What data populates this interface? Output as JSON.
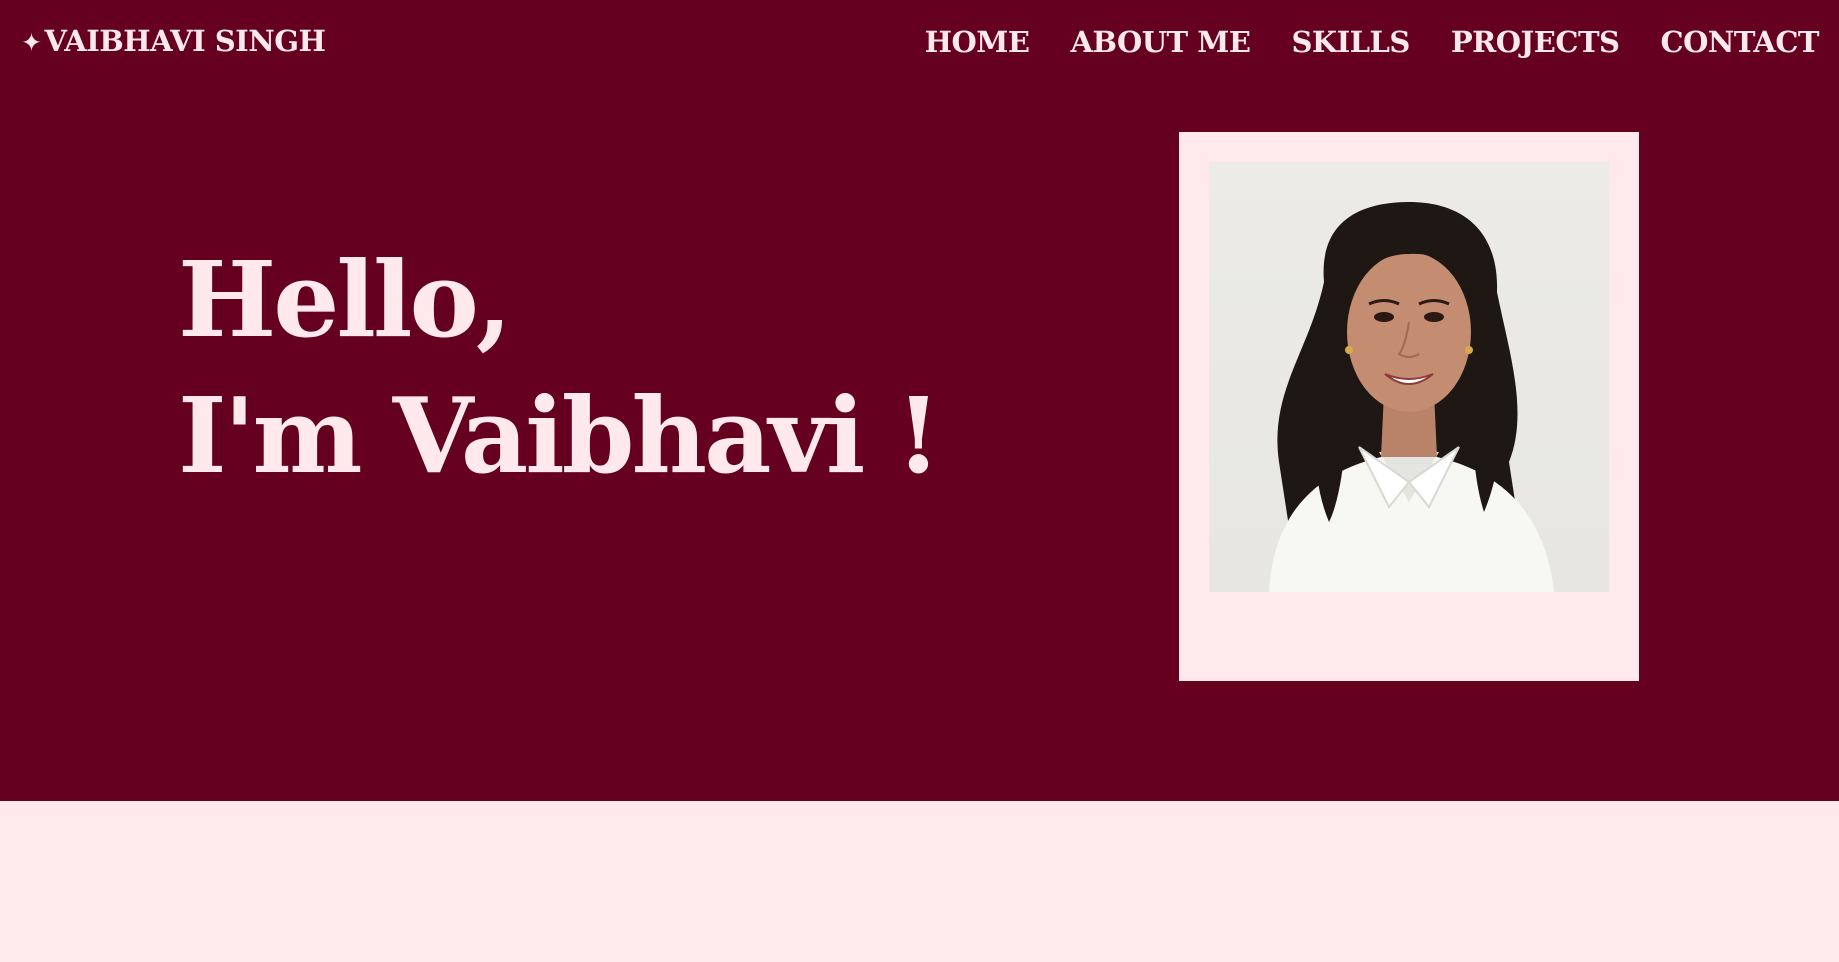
{
  "header": {
    "brand_icon": "✦",
    "brand_name": "VAIBHAVI SINGH"
  },
  "nav": {
    "items": [
      {
        "label": "HOME"
      },
      {
        "label": "ABOUT ME"
      },
      {
        "label": "SKILLS"
      },
      {
        "label": "PROJECTS"
      },
      {
        "label": "CONTACT"
      }
    ]
  },
  "hero": {
    "greeting_line1": "Hello,",
    "greeting_line2": "I'm Vaibhavi !",
    "photo_alt": "Portrait photo"
  },
  "colors": {
    "hero_bg": "#650020",
    "accent_light": "#ffe9ec"
  }
}
